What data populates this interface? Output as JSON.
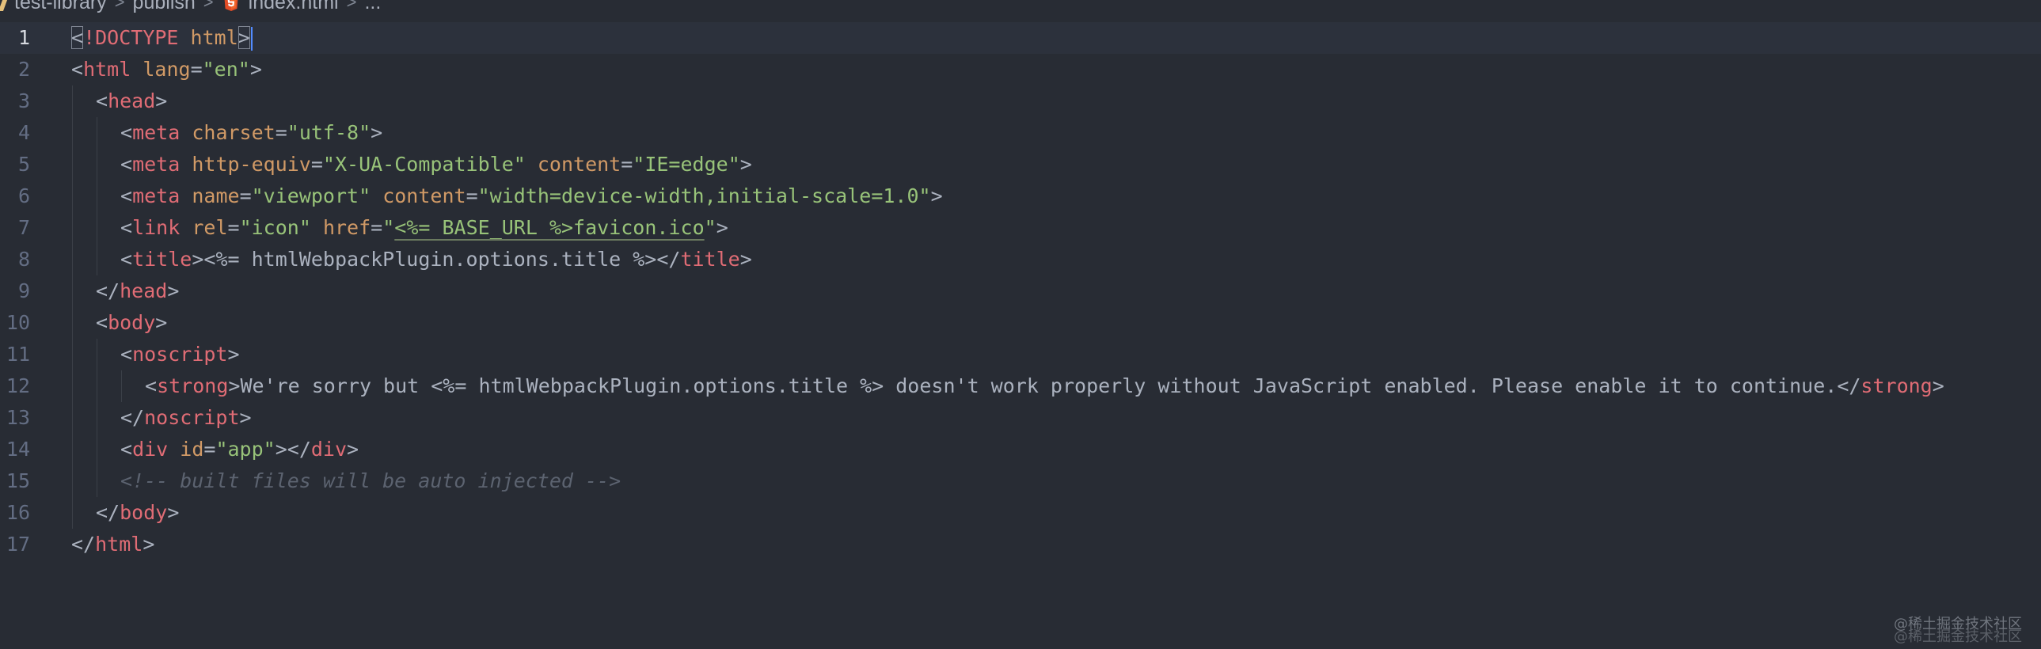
{
  "breadcrumb": {
    "items": [
      "test-library",
      "publish",
      "index.html",
      "..."
    ],
    "separator": ">",
    "file_icon": "html5-icon"
  },
  "editor": {
    "active_line": 1,
    "line_numbers": [
      "1",
      "2",
      "3",
      "4",
      "5",
      "6",
      "7",
      "8",
      "9",
      "10",
      "11",
      "12",
      "13",
      "14",
      "15",
      "16",
      "17"
    ],
    "lines": [
      [
        {
          "t": "punc",
          "v": "<"
        },
        {
          "t": "doctype",
          "v": "!DOCTYPE"
        },
        {
          "t": "text",
          "v": " "
        },
        {
          "t": "doctype-kw",
          "v": "html"
        },
        {
          "t": "punc",
          "v": ">"
        }
      ],
      [
        {
          "t": "punc",
          "v": "<"
        },
        {
          "t": "tag",
          "v": "html"
        },
        {
          "t": "text",
          "v": " "
        },
        {
          "t": "attr",
          "v": "lang"
        },
        {
          "t": "punc",
          "v": "="
        },
        {
          "t": "str",
          "v": "\"en\""
        },
        {
          "t": "punc",
          "v": ">"
        }
      ],
      [
        {
          "t": "punc",
          "v": "<"
        },
        {
          "t": "tag",
          "v": "head"
        },
        {
          "t": "punc",
          "v": ">"
        }
      ],
      [
        {
          "t": "punc",
          "v": "<"
        },
        {
          "t": "tag",
          "v": "meta"
        },
        {
          "t": "text",
          "v": " "
        },
        {
          "t": "attr",
          "v": "charset"
        },
        {
          "t": "punc",
          "v": "="
        },
        {
          "t": "str",
          "v": "\"utf-8\""
        },
        {
          "t": "punc",
          "v": ">"
        }
      ],
      [
        {
          "t": "punc",
          "v": "<"
        },
        {
          "t": "tag",
          "v": "meta"
        },
        {
          "t": "text",
          "v": " "
        },
        {
          "t": "attr",
          "v": "http-equiv"
        },
        {
          "t": "punc",
          "v": "="
        },
        {
          "t": "str",
          "v": "\"X-UA-Compatible\""
        },
        {
          "t": "text",
          "v": " "
        },
        {
          "t": "attr",
          "v": "content"
        },
        {
          "t": "punc",
          "v": "="
        },
        {
          "t": "str",
          "v": "\"IE=edge\""
        },
        {
          "t": "punc",
          "v": ">"
        }
      ],
      [
        {
          "t": "punc",
          "v": "<"
        },
        {
          "t": "tag",
          "v": "meta"
        },
        {
          "t": "text",
          "v": " "
        },
        {
          "t": "attr",
          "v": "name"
        },
        {
          "t": "punc",
          "v": "="
        },
        {
          "t": "str",
          "v": "\"viewport\""
        },
        {
          "t": "text",
          "v": " "
        },
        {
          "t": "attr",
          "v": "content"
        },
        {
          "t": "punc",
          "v": "="
        },
        {
          "t": "str",
          "v": "\"width=device-width,initial-scale=1.0\""
        },
        {
          "t": "punc",
          "v": ">"
        }
      ],
      [
        {
          "t": "punc",
          "v": "<"
        },
        {
          "t": "tag",
          "v": "link"
        },
        {
          "t": "text",
          "v": " "
        },
        {
          "t": "attr",
          "v": "rel"
        },
        {
          "t": "punc",
          "v": "="
        },
        {
          "t": "str",
          "v": "\"icon\""
        },
        {
          "t": "text",
          "v": " "
        },
        {
          "t": "attr",
          "v": "href"
        },
        {
          "t": "punc",
          "v": "="
        },
        {
          "t": "str",
          "v": "\""
        },
        {
          "t": "str-u",
          "v": "<%= BASE_URL %>favicon.ico"
        },
        {
          "t": "str",
          "v": "\""
        },
        {
          "t": "punc",
          "v": ">"
        }
      ],
      [
        {
          "t": "punc",
          "v": "<"
        },
        {
          "t": "tag",
          "v": "title"
        },
        {
          "t": "punc",
          "v": ">"
        },
        {
          "t": "text",
          "v": "<%= htmlWebpackPlugin.options.title %>"
        },
        {
          "t": "punc",
          "v": "</"
        },
        {
          "t": "tag",
          "v": "title"
        },
        {
          "t": "punc",
          "v": ">"
        }
      ],
      [
        {
          "t": "punc",
          "v": "</"
        },
        {
          "t": "tag",
          "v": "head"
        },
        {
          "t": "punc",
          "v": ">"
        }
      ],
      [
        {
          "t": "punc",
          "v": "<"
        },
        {
          "t": "tag",
          "v": "body"
        },
        {
          "t": "punc",
          "v": ">"
        }
      ],
      [
        {
          "t": "punc",
          "v": "<"
        },
        {
          "t": "tag",
          "v": "noscript"
        },
        {
          "t": "punc",
          "v": ">"
        }
      ],
      [
        {
          "t": "punc",
          "v": "<"
        },
        {
          "t": "tag",
          "v": "strong"
        },
        {
          "t": "punc",
          "v": ">"
        },
        {
          "t": "text",
          "v": "We're sorry but <%= htmlWebpackPlugin.options.title %> doesn't work properly without JavaScript enabled. Please enable it to continue."
        },
        {
          "t": "punc",
          "v": "</"
        },
        {
          "t": "tag",
          "v": "strong"
        },
        {
          "t": "punc",
          "v": ">"
        }
      ],
      [
        {
          "t": "punc",
          "v": "</"
        },
        {
          "t": "tag",
          "v": "noscript"
        },
        {
          "t": "punc",
          "v": ">"
        }
      ],
      [
        {
          "t": "punc",
          "v": "<"
        },
        {
          "t": "tag",
          "v": "div"
        },
        {
          "t": "text",
          "v": " "
        },
        {
          "t": "attr",
          "v": "id"
        },
        {
          "t": "punc",
          "v": "="
        },
        {
          "t": "str",
          "v": "\"app\""
        },
        {
          "t": "punc",
          "v": "></"
        },
        {
          "t": "tag",
          "v": "div"
        },
        {
          "t": "punc",
          "v": ">"
        }
      ],
      [
        {
          "t": "comment",
          "v": "<!-- built files will be auto injected -->"
        }
      ],
      [
        {
          "t": "punc",
          "v": "</"
        },
        {
          "t": "tag",
          "v": "body"
        },
        {
          "t": "punc",
          "v": ">"
        }
      ],
      [
        {
          "t": "punc",
          "v": "</"
        },
        {
          "t": "tag",
          "v": "html"
        },
        {
          "t": "punc",
          "v": ">"
        }
      ]
    ],
    "indent_levels": [
      0,
      0,
      1,
      2,
      2,
      2,
      2,
      2,
      1,
      1,
      2,
      3,
      2,
      2,
      2,
      1,
      0
    ]
  },
  "watermark": {
    "text": "@稀土掘金技术社区"
  },
  "colors": {
    "background": "#282c34",
    "tag": "#e06c75",
    "attribute": "#d19a66",
    "string": "#98c379",
    "comment": "#5c6370",
    "cursor": "#528bff"
  }
}
